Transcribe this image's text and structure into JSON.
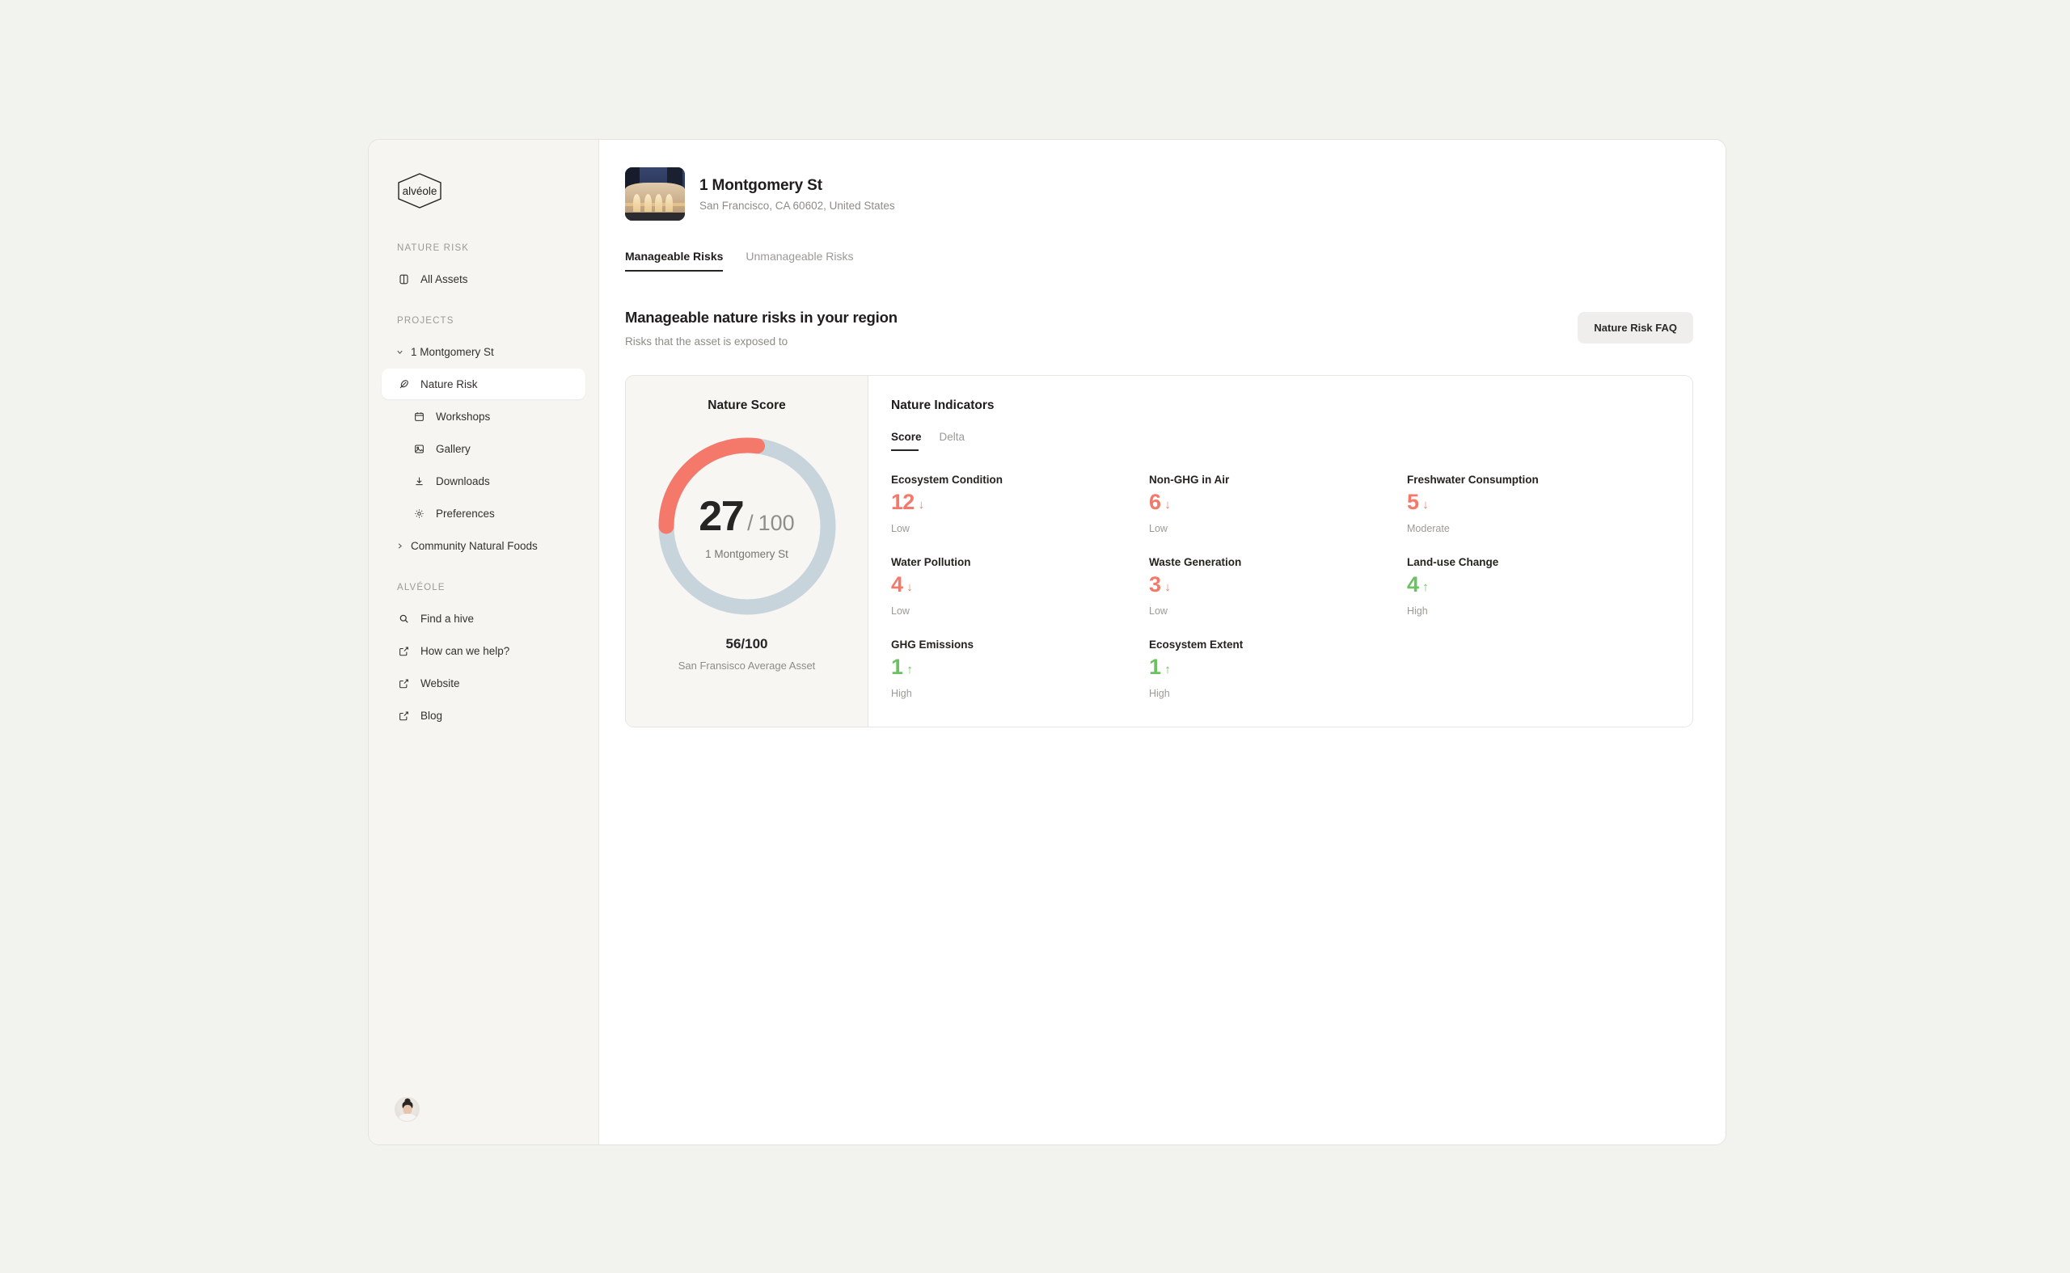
{
  "sidebar": {
    "logo_text": "alvéole",
    "sections": [
      {
        "label": "NATURE RISK"
      },
      {
        "label": "PROJECTS"
      },
      {
        "label": "ALVÉOLE"
      }
    ],
    "nature_risk_items": [
      {
        "label": "All Assets",
        "icon": "cube-icon"
      }
    ],
    "projects": [
      {
        "label": "1 Montgomery St",
        "icon": "chevron-down-icon",
        "expanded": true
      },
      {
        "label": "Nature Risk",
        "icon": "feather-icon",
        "active": true
      },
      {
        "label": "Workshops",
        "icon": "calendar-icon"
      },
      {
        "label": "Gallery",
        "icon": "image-icon"
      },
      {
        "label": "Downloads",
        "icon": "download-icon"
      },
      {
        "label": "Preferences",
        "icon": "gear-icon"
      },
      {
        "label": "Community Natural Foods",
        "icon": "chevron-right-icon",
        "expanded": false
      }
    ],
    "alveole_items": [
      {
        "label": "Find a hive",
        "icon": "search-icon"
      },
      {
        "label": "How can we help?",
        "icon": "external-link-icon"
      },
      {
        "label": "Website",
        "icon": "external-link-icon"
      },
      {
        "label": "Blog",
        "icon": "external-link-icon"
      }
    ]
  },
  "header": {
    "asset_name": "1 Montgomery St",
    "asset_address": "San Francisco, CA 60602, United States",
    "tabs": [
      {
        "label": "Manageable Risks",
        "active": true
      },
      {
        "label": "Unmanageable Risks",
        "active": false
      }
    ]
  },
  "section": {
    "title": "Manageable nature risks in your region",
    "subtitle": "Risks that the asset is exposed to",
    "faq_button": "Nature Risk FAQ"
  },
  "chart_data": {
    "type": "pie",
    "title": "Nature Score",
    "value": 27,
    "max": 100,
    "percent": 27,
    "score_display": "27",
    "divider": "/",
    "max_display": "100",
    "center_label": "1 Montgomery St",
    "comparison_value": "56/100",
    "comparison_label": "San Fransisco Average Asset",
    "arc_color": "#f4796b",
    "track_color": "#c8d4dc",
    "legend_position": "none",
    "grid": false
  },
  "indicators": {
    "title": "Nature Indicators",
    "tabs": [
      {
        "label": "Score",
        "active": true
      },
      {
        "label": "Delta",
        "active": false
      }
    ],
    "items": [
      {
        "name": "Ecosystem Condition",
        "value": "12",
        "trend": "↓",
        "severity": "Low",
        "color": "#f4796b"
      },
      {
        "name": "Non-GHG in Air",
        "value": "6",
        "trend": "↓",
        "severity": "Low",
        "color": "#f4796b"
      },
      {
        "name": "Freshwater Consumption",
        "value": "5",
        "trend": "↓",
        "severity": "Moderate",
        "color": "#f4796b"
      },
      {
        "name": "Water Pollution",
        "value": "4",
        "trend": "↓",
        "severity": "Low",
        "color": "#f4796b"
      },
      {
        "name": "Waste Generation",
        "value": "3",
        "trend": "↓",
        "severity": "Low",
        "color": "#f4796b"
      },
      {
        "name": "Land-use Change",
        "value": "4",
        "trend": "↑",
        "severity": "High",
        "color": "#6cc262"
      },
      {
        "name": "GHG Emissions",
        "value": "1",
        "trend": "↑",
        "severity": "High",
        "color": "#6cc262"
      },
      {
        "name": "Ecosystem Extent",
        "value": "1",
        "trend": "↑",
        "severity": "High",
        "color": "#6cc262"
      }
    ]
  }
}
